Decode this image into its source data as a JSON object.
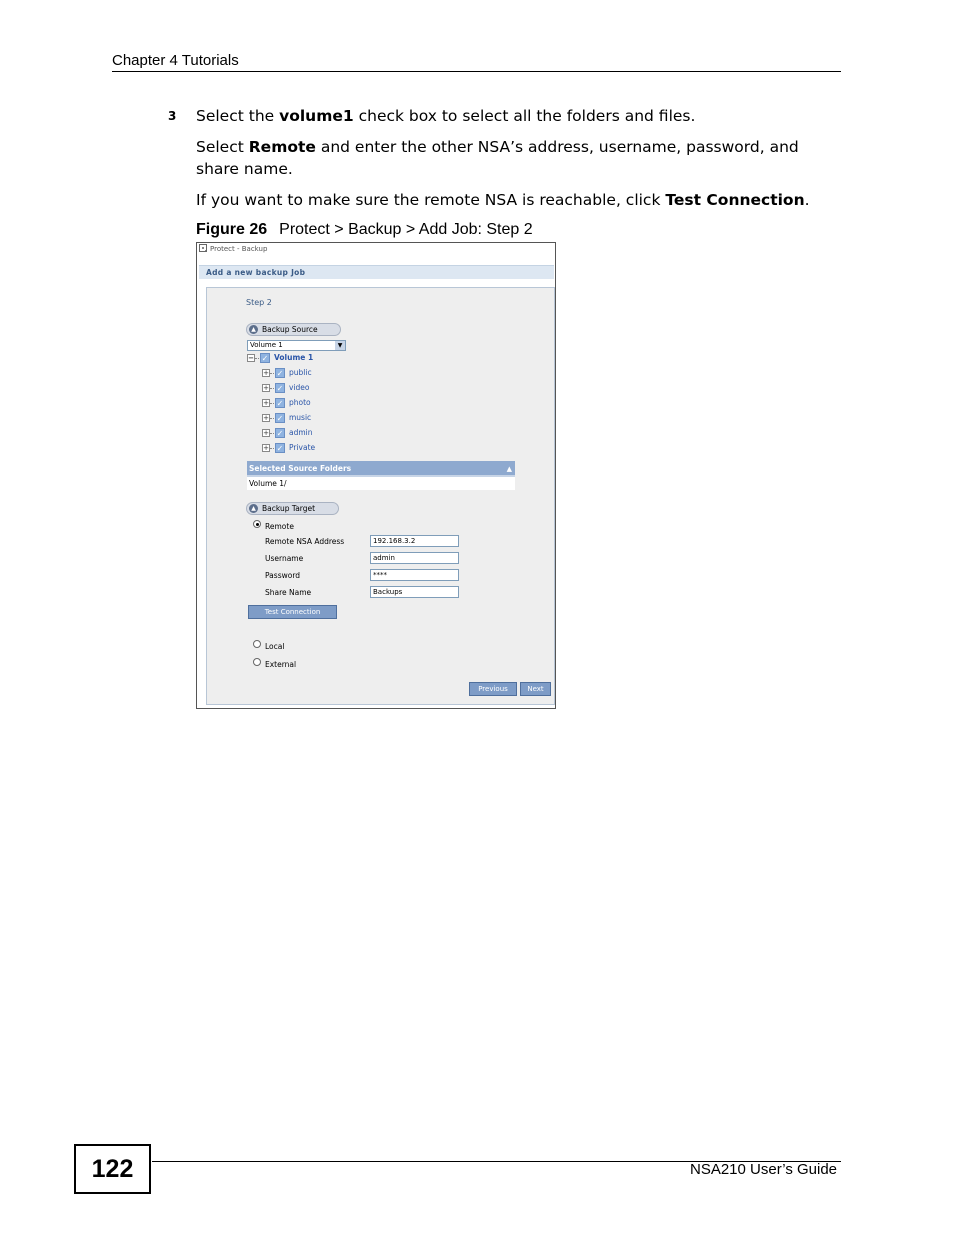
{
  "header": {
    "chapter": "Chapter 4 Tutorials"
  },
  "steps": {
    "number": "3",
    "p1_pre": "Select the ",
    "p1_bold": "volume1",
    "p1_post": " check box to select all the folders and files.",
    "p2_pre": "Select ",
    "p2_bold": "Remote",
    "p2_post": " and enter the other NSA’s address, username, password, and share name.",
    "p3_pre": "If you want to make sure the remote NSA is reachable, click ",
    "p3_bold": "Test Connection",
    "p3_post": "."
  },
  "figure": {
    "label": "Figure 26",
    "caption": "Protect  > Backup > Add Job: Step 2"
  },
  "screenshot": {
    "breadcrumb": "Protect - Backup",
    "job_title": "Add a new backup Job",
    "step_title": "Step 2",
    "backup_source_label": "Backup Source",
    "volume_select": "Volume 1",
    "tree": {
      "root": "Volume 1",
      "children": [
        "public",
        "video",
        "photo",
        "music",
        "admin",
        "Private"
      ]
    },
    "selected_header": "Selected Source Folders",
    "selected_value": "Volume 1/",
    "backup_target_label": "Backup Target",
    "remote_label": "Remote",
    "fields": {
      "address_label": "Remote NSA Address",
      "address_value": "192.168.3.2",
      "username_label": "Username",
      "username_value": "admin",
      "password_label": "Password",
      "password_value": "****",
      "share_label": "Share Name",
      "share_value": "Backups"
    },
    "test_button": "Test Connection",
    "local_label": "Local",
    "external_label": "External",
    "previous_button": "Previous",
    "next_button": "Next"
  },
  "footer": {
    "page_number": "122",
    "guide": "NSA210 User’s Guide"
  }
}
